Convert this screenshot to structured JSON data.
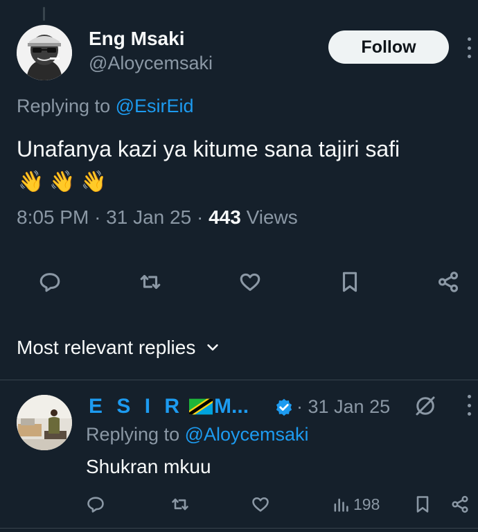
{
  "tweet": {
    "author_name": "Eng Msaki",
    "author_handle": "@Aloycemsaki",
    "follow_label": "Follow",
    "replying_prefix": "Replying to ",
    "replying_handle": "@EsirEid",
    "text": "Unafanya kazi ya kitume sana tajiri safi",
    "emojis": [
      "👋",
      "👋",
      "👋"
    ],
    "time": "8:05 PM",
    "date": "31 Jan 25",
    "views_count": "443",
    "views_label": "Views",
    "actions": [
      "reply-icon",
      "retweet-icon",
      "like-icon",
      "bookmark-icon",
      "share-icon"
    ]
  },
  "sort": {
    "label": "Most relevant replies",
    "icon": "chevron-down-icon"
  },
  "reply": {
    "author_name": "E S I R",
    "author_name_suffix": "M...",
    "flag": "Tanzania flag",
    "verified_color": "#1d9bf0",
    "date": "31 Jan 25",
    "replying_prefix": "Replying to ",
    "replying_handle": "@Aloycemsaki",
    "text": "Shukran mkuu",
    "views_count": "198"
  },
  "colors": {
    "background": "#15202b",
    "text": "#f7f9f9",
    "muted": "#8b98a5",
    "accent": "#1d9bf0",
    "divider": "#38444d"
  }
}
